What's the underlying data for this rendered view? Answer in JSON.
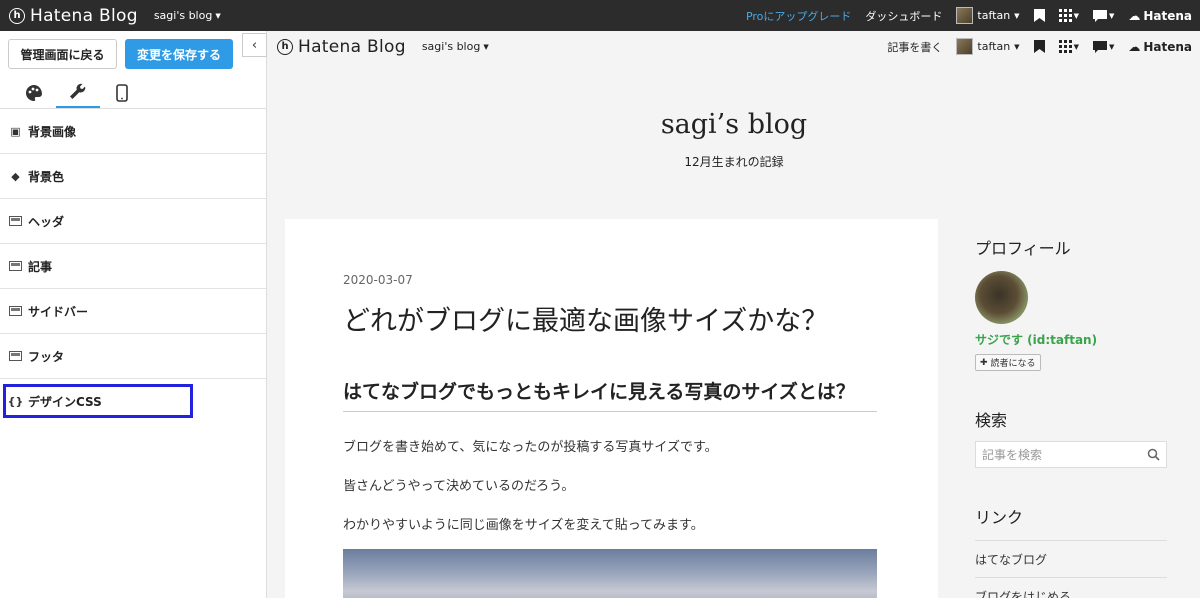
{
  "topbar": {
    "logo_glyph": "h",
    "logo_text": "Hatena Blog",
    "blog_select": "sagi's blog",
    "pro_link": "Proにアップグレード",
    "dashboard": "ダッシュボード",
    "user": "taftan",
    "brand": "Hatena"
  },
  "sidebar": {
    "back_button": "管理画面に戻る",
    "save_button": "変更を保存する",
    "collapse_glyph": "‹",
    "tabs": [
      {
        "icon": "palette-icon",
        "glyph": "🎨"
      },
      {
        "icon": "wrench-icon",
        "glyph": "🔧"
      },
      {
        "icon": "smartphone-icon",
        "glyph": "▯"
      }
    ],
    "items": [
      {
        "label": "背景画像",
        "icon": "image-icon",
        "glyph": "▣"
      },
      {
        "label": "背景色",
        "icon": "paint-bucket-icon",
        "glyph": "◆"
      },
      {
        "label": "ヘッダ",
        "icon": "layout-header-icon"
      },
      {
        "label": "記事",
        "icon": "layout-article-icon"
      },
      {
        "label": "サイドバー",
        "icon": "layout-sidebar-icon"
      },
      {
        "label": "フッタ",
        "icon": "layout-footer-icon"
      },
      {
        "label": "デザインCSS",
        "icon": "css-braces-icon",
        "glyph": "{}"
      }
    ]
  },
  "preview": {
    "bar": {
      "blog_select": "sagi's blog",
      "write": "記事を書く",
      "user": "taftan",
      "brand": "Hatena"
    },
    "blog_title": "sagi’s blog",
    "blog_subtitle": "12月生まれの記録",
    "article": {
      "date": "2020-03-07",
      "title": "どれがブログに最適な画像サイズかな？",
      "h2": "はてなブログでもっともキレイに見える写真のサイズとは？",
      "paragraphs": [
        "ブログを書き始めて、気になったのが投稿する写真サイズです。",
        "皆さんどうやって決めているのだろう。",
        "わかりやすいように同じ画像をサイズを変えて貼ってみます。"
      ]
    },
    "side": {
      "profile_heading": "プロフィール",
      "profile_name": "サジです (id:taftan)",
      "reader_button": "読者になる",
      "search_heading": "検索",
      "search_placeholder": "記事を検索",
      "links_heading": "リンク",
      "links": [
        "はてなブログ",
        "ブログをはじめる"
      ]
    }
  },
  "colors": {
    "topbar_bg": "#2c2c2c",
    "accent": "#2f9ae6",
    "pro_link": "#4aa9e8",
    "highlight": "#2222dd",
    "profile_name": "#3aa34b"
  }
}
